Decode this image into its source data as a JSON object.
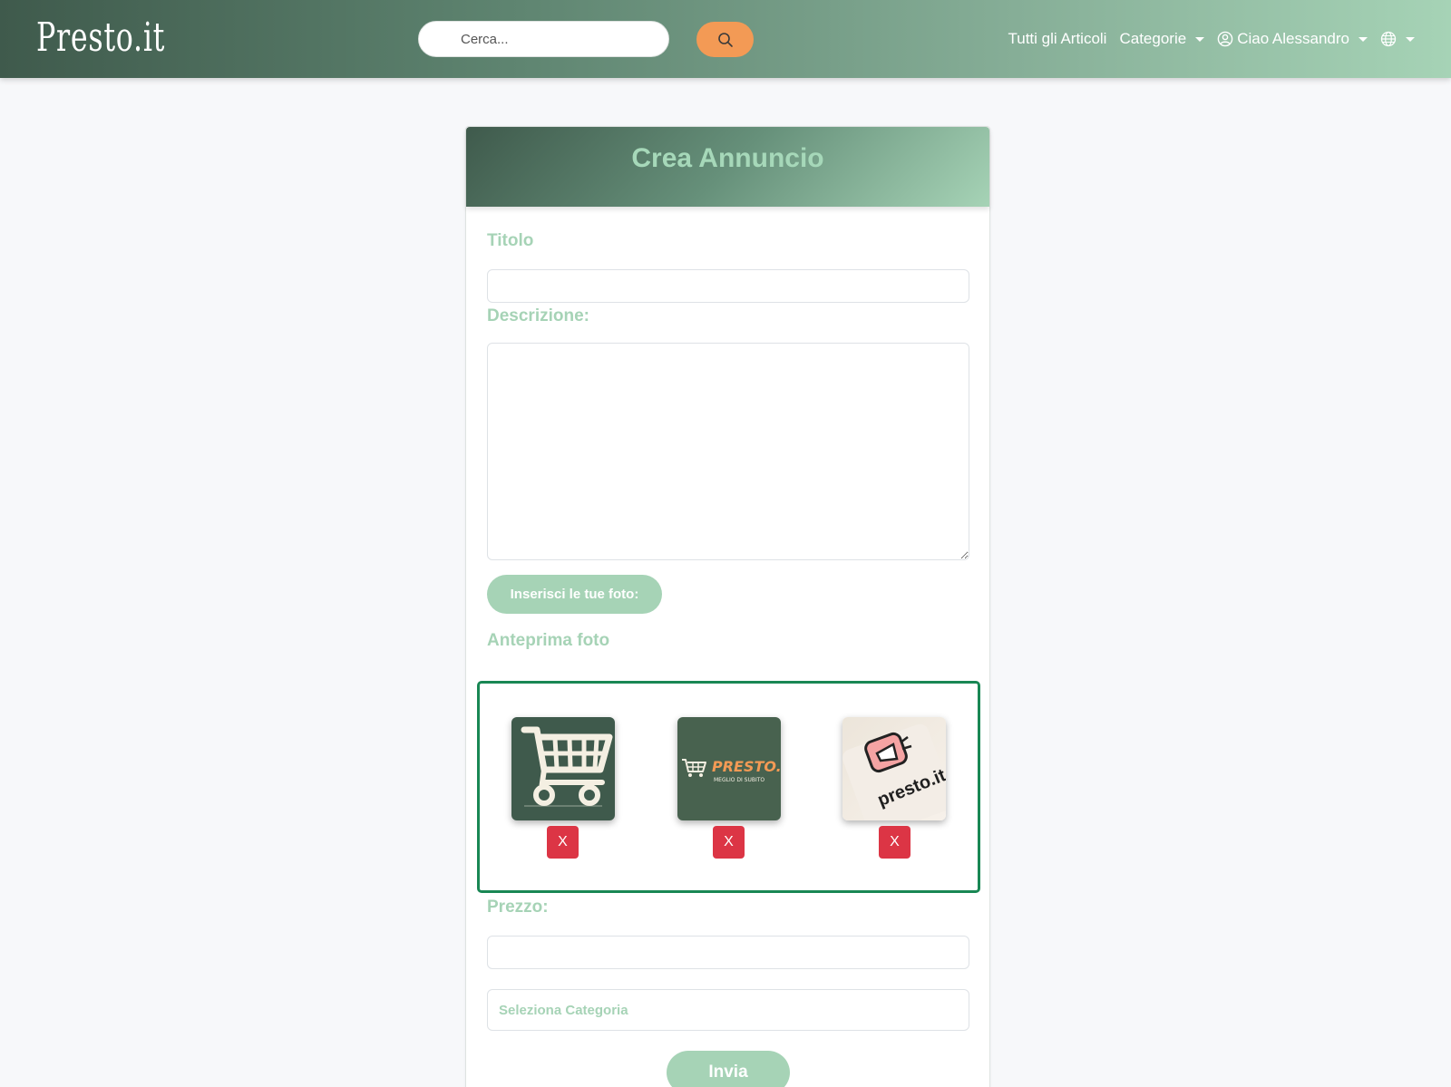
{
  "navbar": {
    "brand": "Presto.it",
    "search_placeholder": "Cerca...",
    "search_icon": "search-icon",
    "links": {
      "all_articles": "Tutti gli Articoli",
      "categories": "Categorie",
      "user": "Ciao Alessandro",
      "user_icon": "user-circle-icon",
      "language_icon": "globe-icon"
    }
  },
  "form": {
    "title": "Crea Annuncio",
    "title_label": "Titolo",
    "title_value": "",
    "description_label": "Descrizione:",
    "description_value": "",
    "upload_label": "Inserisci le tue foto:",
    "preview_label": "Anteprima foto",
    "previews": [
      {
        "image": "cart-logo-image",
        "delete_label": "X"
      },
      {
        "image": "presto-logo-image",
        "delete_label": "X"
      },
      {
        "image": "megaphone-logo-image",
        "delete_label": "X"
      }
    ],
    "presto_logo_text": "PRESTO.IT",
    "presto_logo_sub": "MEGLIO DI SUBITO",
    "megaphone_logo_text": "presto.it",
    "price_label": "Prezzo:",
    "price_value": "",
    "category_placeholder": "Seleziona Categoria",
    "submit_label": "Invia"
  },
  "colors": {
    "accent": "#a6d3b6",
    "search_button": "#f39a55",
    "delete_button": "#dc3545",
    "preview_border": "#198754"
  }
}
